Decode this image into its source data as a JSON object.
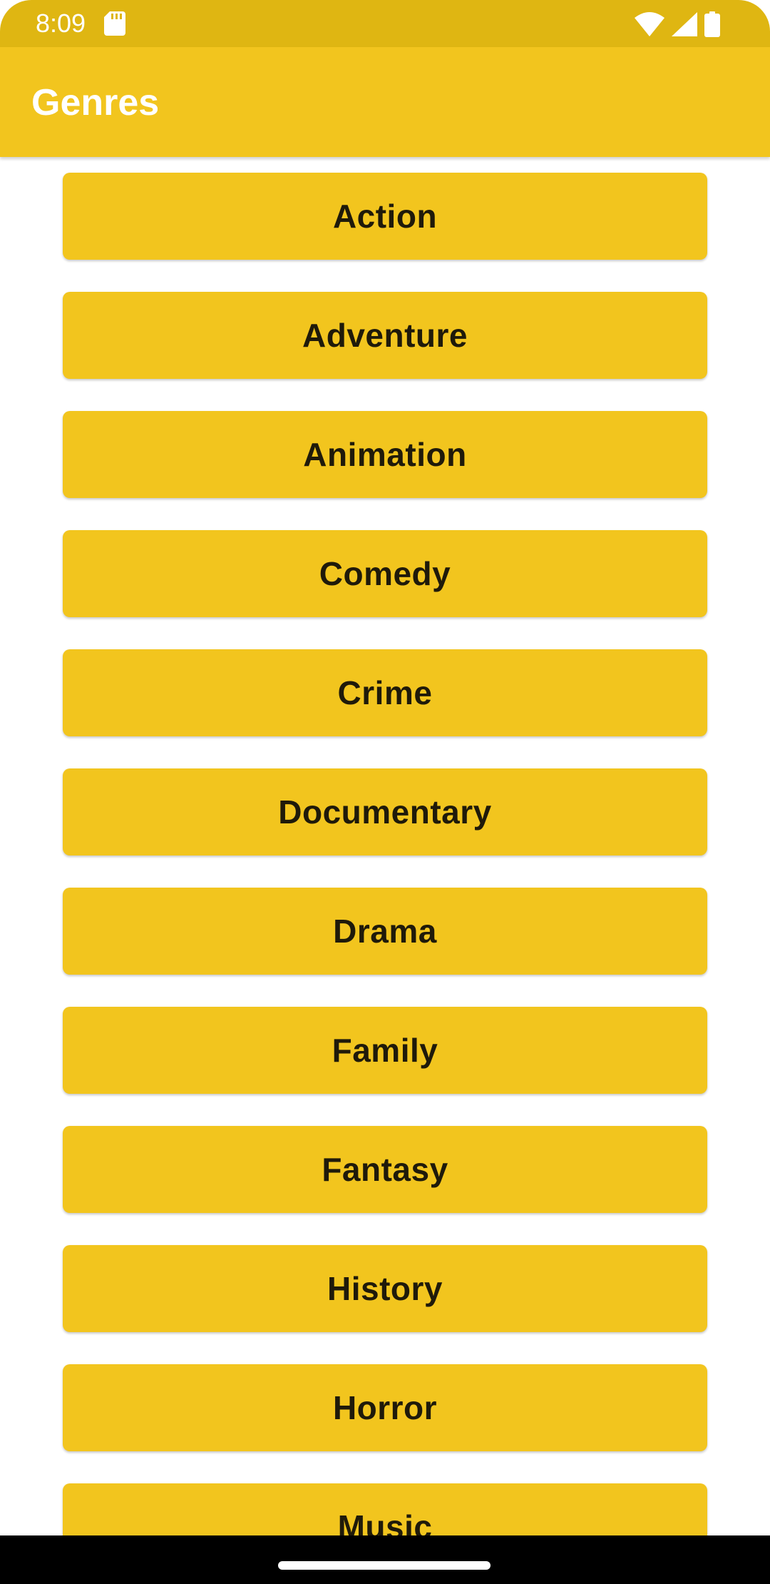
{
  "status_bar": {
    "time": "8:09",
    "icons": [
      "sd-card-icon",
      "wifi-icon",
      "cellular-signal-icon",
      "battery-icon"
    ]
  },
  "app_bar": {
    "title": "Genres"
  },
  "genres": [
    "Action",
    "Adventure",
    "Animation",
    "Comedy",
    "Crime",
    "Documentary",
    "Drama",
    "Family",
    "Fantasy",
    "History",
    "Horror",
    "Music"
  ],
  "colors": {
    "status_bar": "#DFB612",
    "app_bar": "#F2C51E",
    "button": "#F2C51E",
    "button_text": "#1F1A0A",
    "title_text": "#FFFFFF",
    "background": "#FFFFFF",
    "nav_bar": "#000000"
  }
}
